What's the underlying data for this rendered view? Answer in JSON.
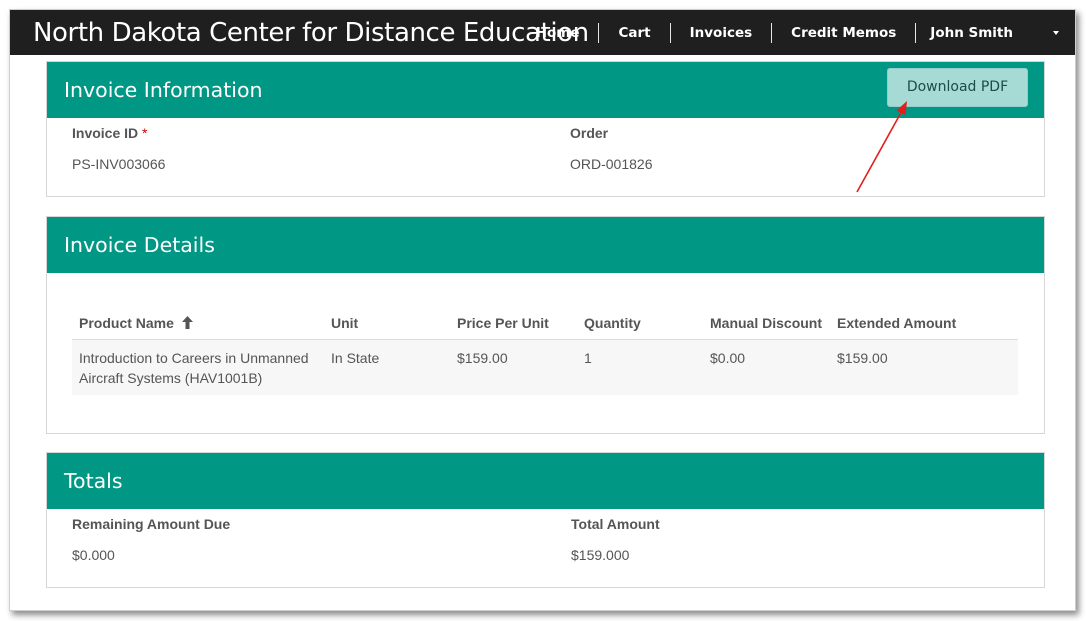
{
  "navbar": {
    "brand": "North Dakota Center for Distance Education",
    "links": [
      "Home",
      "Cart",
      "Invoices",
      "Credit Memos"
    ],
    "user": "John Smith"
  },
  "invoice_info": {
    "title": "Invoice Information",
    "download_label": "Download PDF",
    "invoice_id_label": "Invoice ID",
    "required_mark": "*",
    "invoice_id": "PS-INV003066",
    "order_label": "Order",
    "order": "ORD-001826"
  },
  "invoice_details": {
    "title": "Invoice Details",
    "columns": [
      "Product Name",
      "Unit",
      "Price Per Unit",
      "Quantity",
      "Manual Discount",
      "Extended Amount"
    ],
    "rows": [
      {
        "product": "Introduction to Careers in Unmanned Aircraft Systems (HAV1001B)",
        "unit": "In State",
        "price": "$159.00",
        "quantity": "1",
        "discount": "$0.00",
        "extended": "$159.00"
      }
    ]
  },
  "totals": {
    "title": "Totals",
    "remaining_label": "Remaining Amount Due",
    "remaining": "$0.000",
    "total_label": "Total Amount",
    "total": "$159.000"
  },
  "colors": {
    "navbar": "#1f1f1f",
    "panel_header": "#009784",
    "button": "#a6dbd5",
    "annotation_arrow": "#e41e1e"
  }
}
